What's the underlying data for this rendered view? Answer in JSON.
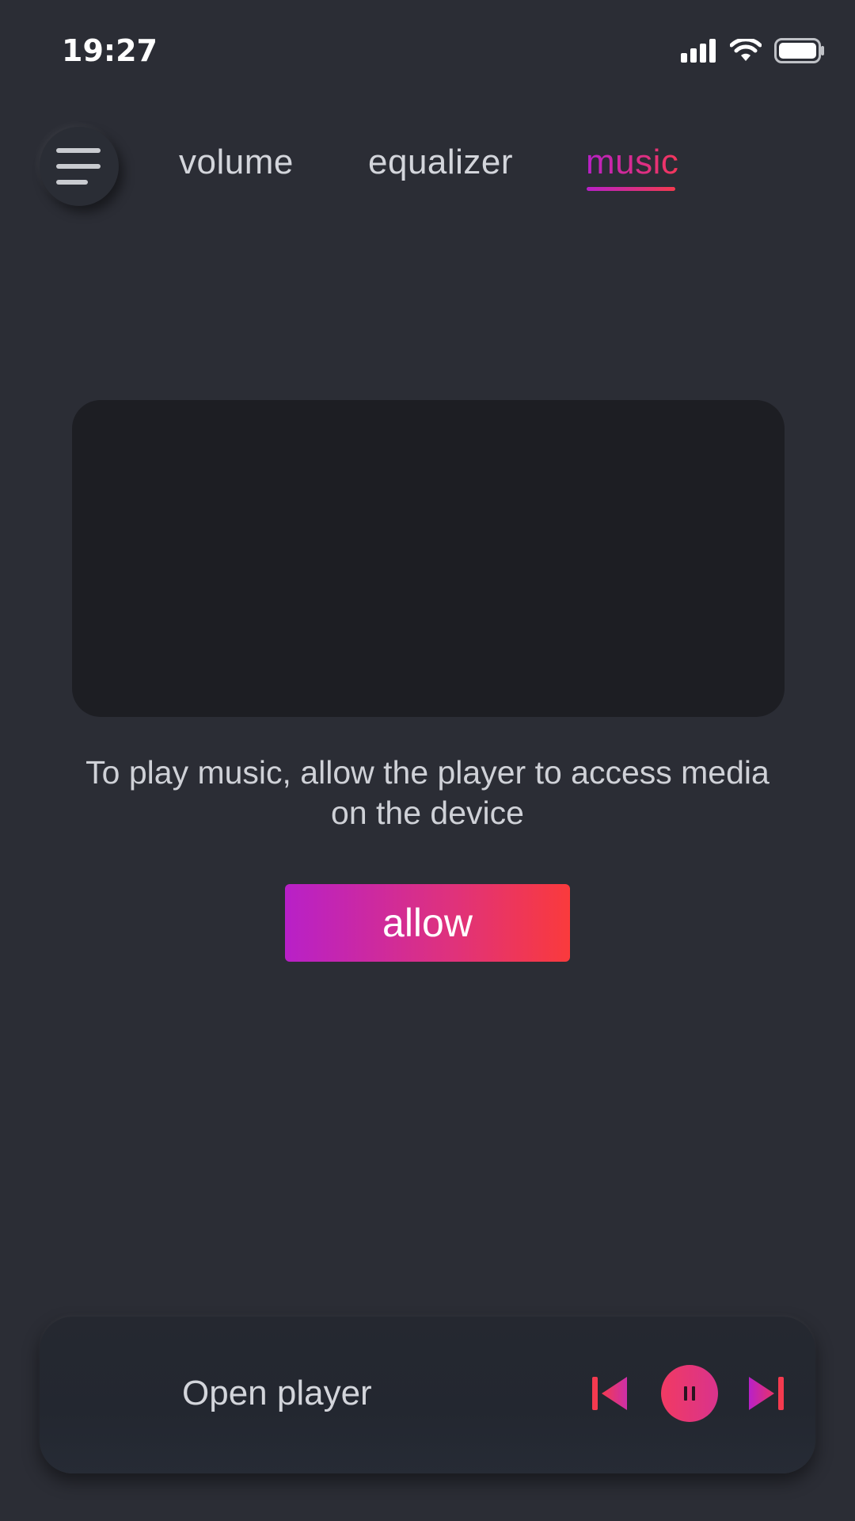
{
  "status_bar": {
    "time": "19:27",
    "icons": [
      "signal-icon",
      "wifi-icon",
      "battery-icon"
    ]
  },
  "nav": {
    "menu_icon": "hamburger-menu-icon",
    "tabs": [
      {
        "label": "volume",
        "active": false
      },
      {
        "label": "equalizer",
        "active": false
      },
      {
        "label": "music",
        "active": true
      }
    ]
  },
  "main": {
    "permission_text": "To play music, allow the player to access media on the device",
    "allow_label": "allow"
  },
  "player": {
    "wave_icon": "waveform-icon",
    "open_label": "Open player",
    "controls": [
      "skip-previous-icon",
      "pause-icon",
      "skip-next-icon"
    ]
  },
  "colors": {
    "background": "#2b2d35",
    "accent_start": "#b820c8",
    "accent_end": "#fa3a3c",
    "placeholder": "#1d1e23"
  }
}
